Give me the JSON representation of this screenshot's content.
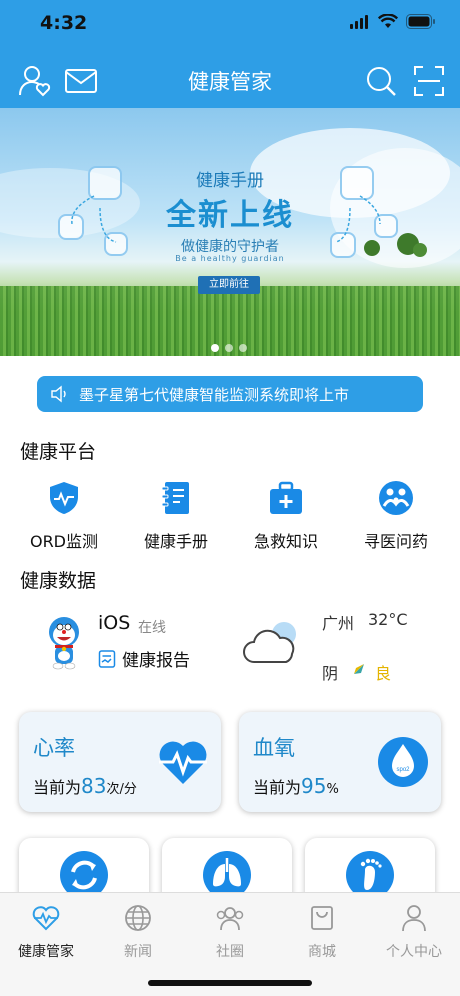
{
  "status_bar": {
    "time": "4:32"
  },
  "nav": {
    "title": "健康管家",
    "icons": [
      "user-heart-icon",
      "mail-icon",
      "search-icon",
      "scan-icon"
    ]
  },
  "banner": {
    "subtitle": "健康手册",
    "headline": "全新上线",
    "tagline": "做健康的守护者",
    "tagline_en": "Be a healthy guardian",
    "button": "立即前往",
    "slides": 3,
    "active_slide": 1
  },
  "notice": {
    "text": "墨子星第七代健康智能监测系统即将上市",
    "icon": "speaker-icon"
  },
  "platform": {
    "title": "健康平台",
    "items": [
      {
        "label": "ORD监测",
        "icon": "shield-pulse-icon"
      },
      {
        "label": "健康手册",
        "icon": "notebook-icon"
      },
      {
        "label": "急救知识",
        "icon": "first-aid-kit-icon"
      },
      {
        "label": "寻医问药",
        "icon": "family-care-icon"
      }
    ]
  },
  "health_data": {
    "title": "健康数据",
    "device": {
      "name": "iOS",
      "status": "在线"
    },
    "report_label": "健康报告",
    "weather": {
      "city": "广州",
      "temperature": "32°C",
      "condition": "阴",
      "air_quality": "良"
    }
  },
  "cards": [
    {
      "name": "心率",
      "prefix": "当前为",
      "value": "83",
      "unit": "次/分",
      "icon": "heart-rate-icon"
    },
    {
      "name": "血氧",
      "prefix": "当前为",
      "value": "95",
      "unit": "%",
      "icon": "spo2-drop-icon",
      "icon_text": "spo2"
    }
  ],
  "mini_cards": [
    {
      "icon": "recycle-icon"
    },
    {
      "icon": "lungs-icon"
    },
    {
      "icon": "footprint-icon"
    }
  ],
  "tabs": [
    {
      "label": "健康管家",
      "icon": "heart-pulse-tab-icon",
      "active": true
    },
    {
      "label": "新闻",
      "icon": "globe-icon",
      "active": false
    },
    {
      "label": "社圈",
      "icon": "group-icon",
      "active": false
    },
    {
      "label": "商城",
      "icon": "shopping-bag-icon",
      "active": false
    },
    {
      "label": "个人中心",
      "icon": "person-icon",
      "active": false
    }
  ],
  "colors": {
    "primary": "#2e9ee6",
    "accent_text": "#1f88c9",
    "aqi_good": "#e4b400",
    "icon_blue": "#1a8ae6"
  }
}
